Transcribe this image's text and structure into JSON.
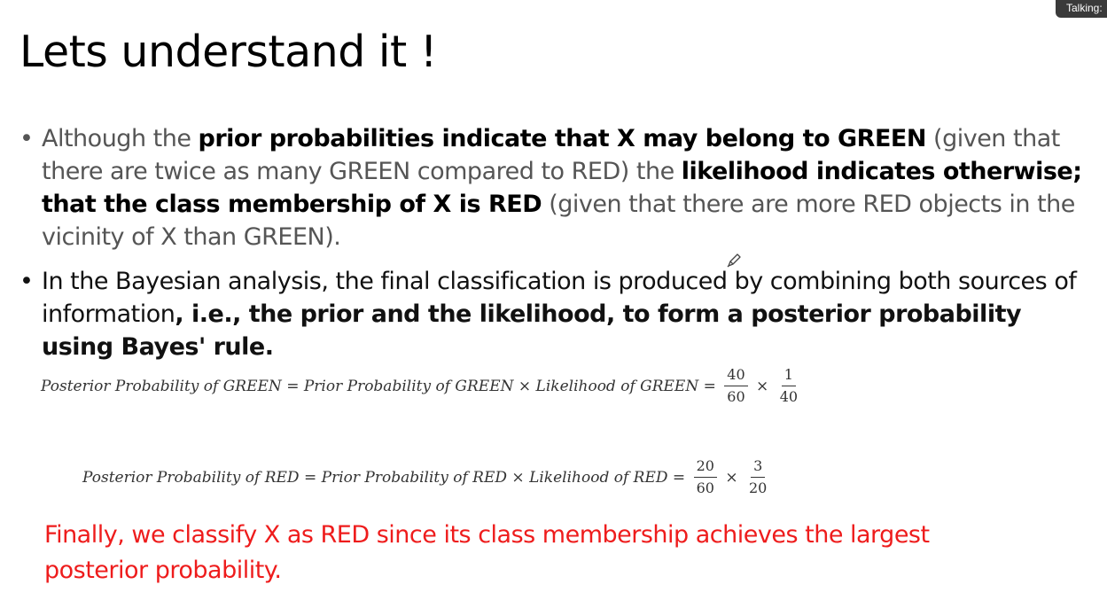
{
  "overlay": {
    "talking_label": "Talking:"
  },
  "slide": {
    "title": "Lets understand it !",
    "bullet_symbol": "•",
    "bullet1": {
      "t1": "Although the ",
      "b1": "prior probabilities indicate that X may belong to GREEN",
      "t2": " (given that there are twice as many GREEN compared to RED) the ",
      "b2": "likelihood indicates otherwise; that the class membership of X is RED",
      "t3": " (given that there are more RED objects in the vicinity of X than GREEN)."
    },
    "bullet2": {
      "t1": "In the Bayesian analysis, the final classification is produced by combining both sources of information",
      "b1": ", i.e., the prior and the likelihood, to form a posterior probability using Bayes' rule."
    },
    "equations": {
      "green": {
        "lhs": "Posterior Probability of GREEN",
        "eq": " = ",
        "mid": "Prior Probability of GREEN",
        "times": " × ",
        "rhs": "Likelihood of GREEN",
        "f1_num": "40",
        "f1_den": "60",
        "f2_num": "1",
        "f2_den": "40"
      },
      "red": {
        "lhs": "Posterior Probability of RED",
        "eq": " = ",
        "mid": "Prior Probability of RED",
        "times": " × ",
        "rhs": "Likelihood of RED",
        "f1_num": "20",
        "f1_den": "60",
        "f2_num": "3",
        "f2_den": "20"
      }
    },
    "conclusion": "Finally, we classify X as RED since its class membership achieves the largest posterior probability.",
    "cursor_icon": "pencil-icon"
  }
}
